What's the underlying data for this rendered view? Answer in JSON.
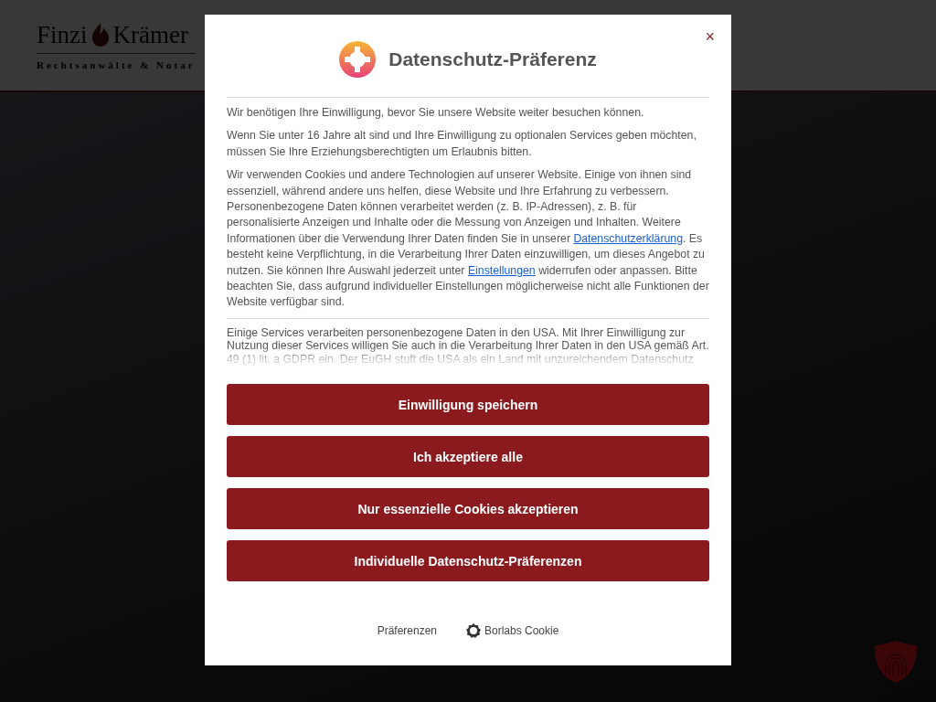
{
  "site": {
    "logo_name_left": "Finzi",
    "logo_name_right": "Krämer",
    "logo_tagline": "Rechtsanwälte & Notar"
  },
  "dialog": {
    "title": "Datenschutz-Präferenz",
    "close": "×",
    "paragraphs": [
      "Wir benötigen Ihre Einwilligung, bevor Sie unsere Website weiter besuchen können.",
      "Wenn Sie unter 16 Jahre alt sind und Ihre Einwilligung zu optionalen Services geben möchten, müssen Sie Ihre Erziehungsberechtigten um Erlaubnis bitten.",
      [
        {
          "kind": "text",
          "text": "Wir verwenden Cookies und andere Technologien auf unserer Website. Einige von ihnen sind essenziell, während andere uns helfen, diese Website und Ihre Erfahrung zu verbessern. Personenbezogene Daten können verarbeitet werden (z. B. IP-Adressen), z. B. für personalisierte Anzeigen und Inhalte oder die Messung von Anzeigen und Inhalten. Weitere Informationen über die Verwendung Ihrer Daten finden Sie in unserer "
        },
        {
          "kind": "link",
          "text": "Datenschutzerklärung"
        },
        {
          "kind": "text",
          "text": ". Es besteht keine Verpflichtung, in die Verarbeitung Ihrer Daten einzuwilligen, um dieses Angebot zu nutzen. Sie können Ihre Auswahl jederzeit unter "
        },
        {
          "kind": "link",
          "text": "Einstellungen"
        },
        {
          "kind": "text",
          "text": " widerrufen oder anpassen. Bitte beachten Sie, dass aufgrund individueller Einstellungen möglicherweise nicht alle Funktionen der Website verfügbar sind."
        }
      ]
    ],
    "usa_notice": "Einige Services verarbeiten personenbezogene Daten in den USA. Mit Ihrer Einwilligung zur Nutzung dieser Services willigen Sie auch in die Verarbeitung Ihrer Daten in den USA gemäß Art. 49 (1) lit. a GDPR ein. Der EuGH stuft die USA als ein Land mit unzureichendem Datenschutz",
    "buttons": [
      "Einwilligung speichern",
      "Ich akzeptiere alle",
      "Nur essenzielle Cookies akzeptieren",
      "Individuelle Datenschutz-Präferenzen"
    ],
    "footer_links": [
      "Präferenzen",
      "Borlabs Cookie"
    ]
  }
}
